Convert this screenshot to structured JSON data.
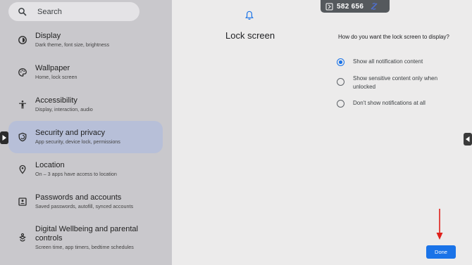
{
  "search": {
    "placeholder": "Search",
    "icon": "search-icon"
  },
  "sidebar": {
    "items": [
      {
        "label": "Display",
        "sub": "Dark theme, font size, brightness",
        "icon": "display-settings-icon"
      },
      {
        "label": "Wallpaper",
        "sub": "Home, lock screen",
        "icon": "palette-icon"
      },
      {
        "label": "Accessibility",
        "sub": "Display, interaction, audio",
        "icon": "accessibility-icon"
      },
      {
        "label": "Security and privacy",
        "sub": "App security, device lock, permissions",
        "icon": "shield-icon",
        "selected": true
      },
      {
        "label": "Location",
        "sub": "On – 3 apps have access to location",
        "icon": "location-pin-icon"
      },
      {
        "label": "Passwords and accounts",
        "sub": "Saved passwords, autofill, synced accounts",
        "icon": "account-box-icon"
      },
      {
        "label": "Digital Wellbeing and parental controls",
        "sub": "Screen time, app timers, bedtime schedules",
        "icon": "wellbeing-icon"
      }
    ]
  },
  "main": {
    "title": "Lock screen",
    "question": "How do you want the lock screen to display?",
    "options": [
      {
        "label": "Show all notification content",
        "checked": true
      },
      {
        "label": "Show sensitive content only when unlocked",
        "checked": false
      },
      {
        "label": "Don't show notifications at all",
        "checked": false
      }
    ],
    "done_label": "Done"
  },
  "overlay": {
    "counter": "582 656"
  },
  "colors": {
    "accent": "#1a73e8",
    "selected_bg": "#b7bfd8",
    "sidebar_bg": "#c9c8cc",
    "arrow": "#e0201b"
  }
}
